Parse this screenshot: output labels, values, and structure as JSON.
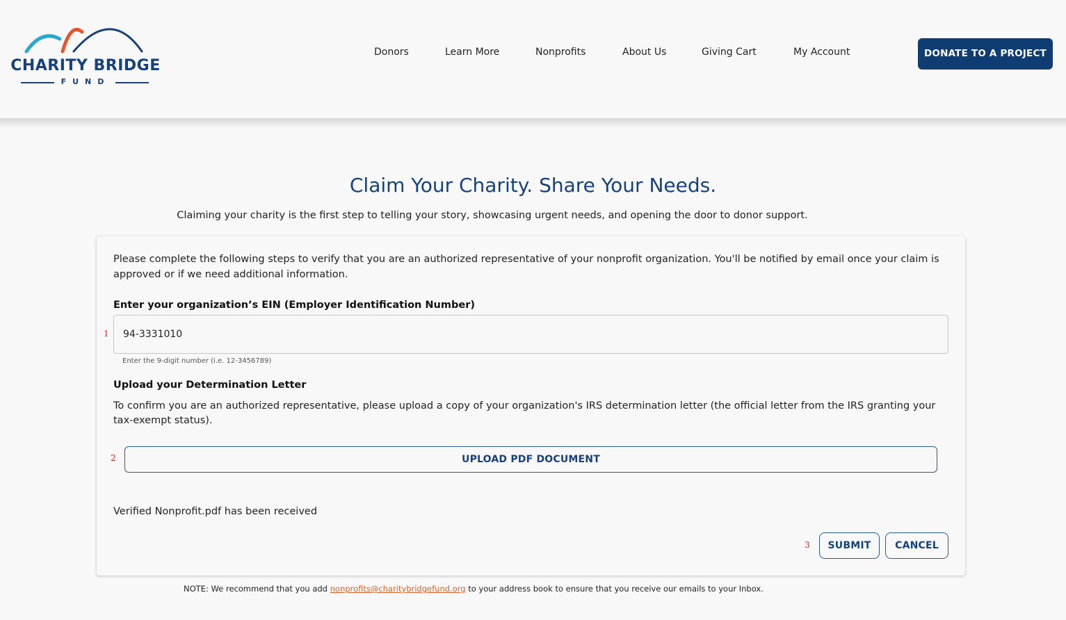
{
  "logo": {
    "name": "CHARITY BRIDGE",
    "sub": "FUND"
  },
  "nav": {
    "items": [
      "Donors",
      "Learn More",
      "Nonprofits",
      "About Us",
      "Giving Cart",
      "My Account"
    ],
    "cta": "DONATE TO A PROJECT"
  },
  "colors": {
    "brand_navy": "#16417a",
    "button_navy": "#0f3d73",
    "arch_teal": "#2aa7c9",
    "arch_orange": "#e4572e",
    "link_orange": "#d9622b",
    "marker_red": "#d12a2a"
  },
  "page": {
    "title": "Claim Your Charity. Share Your Needs.",
    "subtitle": "Claiming your charity is the first step to telling your story, showcasing urgent needs, and opening the door to donor support."
  },
  "form": {
    "intro": "Please complete the following steps to verify that you are an authorized representative of your nonprofit organization. You'll be notified by email once your claim is approved or if we need additional information.",
    "ein_label": "Enter your organization’s EIN (Employer Identification Number)",
    "ein_value": "94-3331010",
    "ein_helper": "Enter the 9-digit number (i.e. 12-3456789)",
    "upload_label": "Upload your Determination Letter",
    "upload_desc": "To confirm you are an authorized representative, please upload a copy of your organization's IRS determination letter (the official letter from the IRS granting your tax-exempt status).",
    "upload_button": "UPLOAD PDF DOCUMENT",
    "received_text": "Verified Nonprofit.pdf has been received",
    "submit": "SUBMIT",
    "cancel": "CANCEL",
    "markers": [
      "1",
      "2",
      "3"
    ]
  },
  "note": {
    "prefix": "NOTE: We recommend that you add ",
    "email": "nonprofits@charitybridgefund.org",
    "suffix": " to your address book to ensure that you receive our emails to your Inbox."
  }
}
